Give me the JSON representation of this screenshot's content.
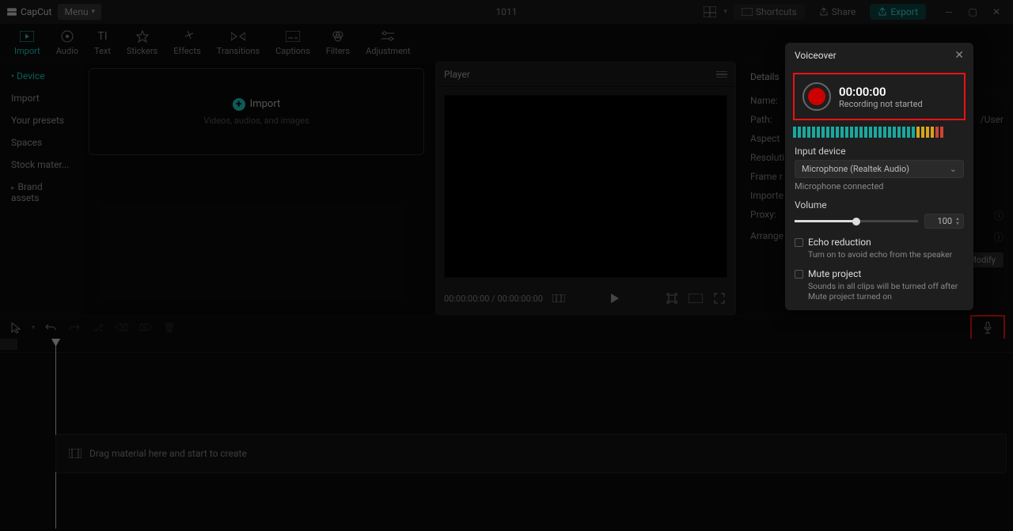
{
  "app": {
    "name": "CapCut",
    "menu": "Menu",
    "project": "1011"
  },
  "titlebar": {
    "shortcuts": "Shortcuts",
    "share": "Share",
    "export": "Export"
  },
  "tools": {
    "import": "Import",
    "audio": "Audio",
    "text": "Text",
    "stickers": "Stickers",
    "effects": "Effects",
    "transitions": "Transitions",
    "captions": "Captions",
    "filters": "Filters",
    "adjustment": "Adjustment"
  },
  "sidebar": {
    "device": "Device",
    "import": "Import",
    "presets": "Your presets",
    "spaces": "Spaces",
    "stock": "Stock mater...",
    "brand": "Brand assets"
  },
  "media": {
    "import": "Import",
    "sub": "Videos, audios, and images"
  },
  "player": {
    "title": "Player",
    "time": "00:00:00:00 / 00:00:00:00"
  },
  "details": {
    "title": "Details",
    "name": "Name:",
    "path": "Path:",
    "aspect": "Aspect",
    "resolution": "Resoluti",
    "frame": "Frame r",
    "imported": "Importe",
    "proxy": "Proxy:",
    "arrange": "Arrange",
    "path_val": "/User",
    "modify": "Modify"
  },
  "timeline": {
    "drag": "Drag material here and start to create"
  },
  "voiceover": {
    "title": "Voiceover",
    "time": "00:00:00",
    "status": "Recording not started",
    "input_label": "Input device",
    "input_value": "Microphone (Realtek Audio)",
    "mic_status": "Microphone connected",
    "volume_label": "Volume",
    "volume_value": "100",
    "echo_title": "Echo reduction",
    "echo_sub": "Turn on to avoid echo from the speaker",
    "mute_title": "Mute project",
    "mute_sub": "Sounds in all clips will be turned off after Mute project turned on"
  }
}
